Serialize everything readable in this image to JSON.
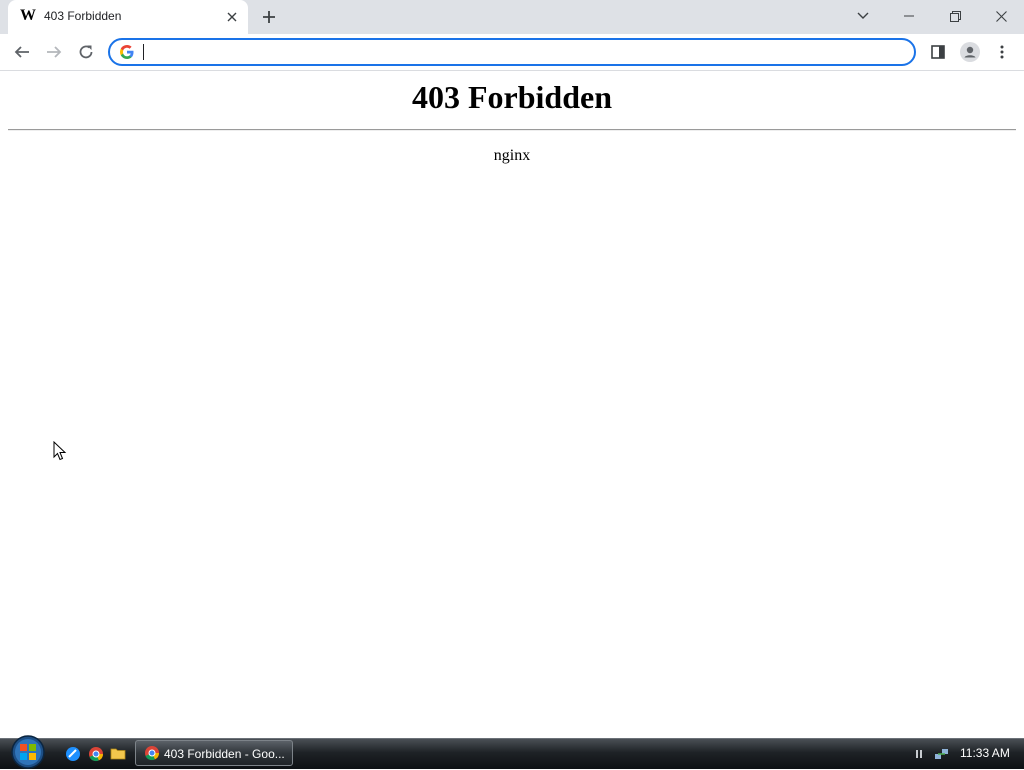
{
  "browser": {
    "tab": {
      "title": "403 Forbidden",
      "favicon_letter": "W",
      "close_glyph": "✕"
    },
    "new_tab_glyph": "+",
    "omnibox": {
      "value": "",
      "placeholder": ""
    },
    "icons": {
      "back": "back-arrow-icon",
      "forward": "forward-arrow-icon",
      "reload": "reload-icon",
      "side_panel": "side-panel-icon",
      "profile": "profile-icon",
      "menu": "kebab-menu-icon",
      "tab_search": "chevron-down-icon",
      "minimize": "minimize-icon",
      "restore": "restore-icon",
      "close": "close-icon"
    },
    "colors": {
      "frame": "#dee1e6",
      "focus_ring": "#1a73e8"
    }
  },
  "page": {
    "heading": "403 Forbidden",
    "server": "nginx"
  },
  "taskbar": {
    "task_button_label": "403 Forbidden - Goo...",
    "clock": "11:33 AM"
  }
}
